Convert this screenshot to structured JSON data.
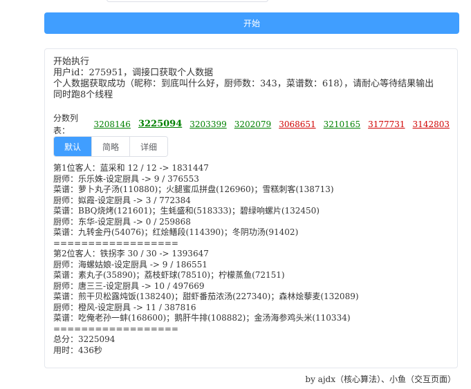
{
  "start_button": "开始",
  "log_lines": [
    "开始执行",
    "用户id：275951，调接口获取个人数据",
    "个人数据获取成功（昵称：到底叫什么好，厨师数：343，菜谱数：618），请耐心等待结果输出",
    "同时跑8个线程"
  ],
  "scores": {
    "label": "分数列表：",
    "items": [
      {
        "value": "3208146",
        "color": "#008000"
      },
      {
        "value": "3225094",
        "color": "#008000"
      },
      {
        "value": "3203399",
        "color": "#008000"
      },
      {
        "value": "3202079",
        "color": "#008000"
      },
      {
        "value": "3068651",
        "color": "#d00000"
      },
      {
        "value": "3210165",
        "color": "#008000"
      },
      {
        "value": "3177731",
        "color": "#d00000"
      },
      {
        "value": "3142803",
        "color": "#d00000"
      }
    ]
  },
  "tabs": [
    {
      "label": "默认",
      "active": true
    },
    {
      "label": "简略",
      "active": false
    },
    {
      "label": "详细",
      "active": false
    }
  ],
  "detail_lines": [
    "第1位客人：蓝采和 12 / 12 -> 1831447",
    "厨师：乐乐姝-设定厨具 -> 9 / 376553",
    "菜谱：萝卜丸子汤(110880)；火腿蜜瓜拼盘(126960)；雪糕刺客(138713)",
    "厨师：姒霞-设定厨具 -> 3 / 772384",
    "菜谱：BBQ烧烤(121601)；生蚝盛和(518333)；碧绿响螺片(132450)",
    "厨师：东华-设定厨具 -> 0 / 259868",
    "菜谱：九转金丹(54076)；红烩鳝段(114390)；冬阴功汤(91402)",
    "==================",
    "第2位客人：铁拐李 30 / 30 -> 1393647",
    "厨师：海螺姑娘-设定厨具 -> 9 / 186551",
    "菜谱：素丸子(35890)；荔枝虾球(78510)；柠檬蒸鱼(72151)",
    "厨师：唐三三-设定厨具 -> 10 / 497669",
    "菜谱：煎干贝松露炖饭(138240)；甜虾番茄浓汤(227340)；森林烩藜麦(132089)",
    "厨师：橙风-设定厨具 -> 11 / 387816",
    "菜谱：吃俺老孙一蚌(168600)；鹅肝牛排(108882)；金汤海参鸡头米(110334)",
    "==================",
    "总分：3225094",
    "用时：436秒"
  ],
  "footer": "by ajdx（核心算法）、小鱼（交互页面）"
}
